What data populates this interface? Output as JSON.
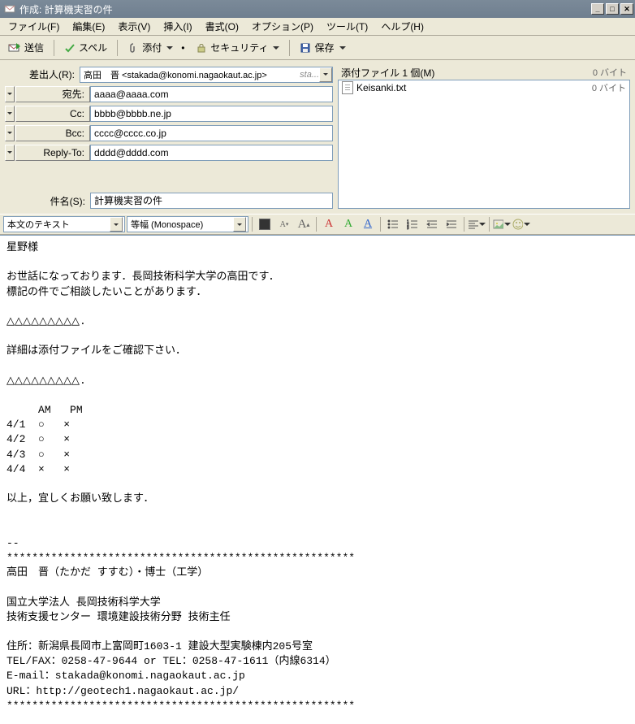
{
  "window": {
    "title": "作成: 計算機実習の件"
  },
  "menu": {
    "file": "ファイル(F)",
    "edit": "編集(E)",
    "view": "表示(V)",
    "insert": "挿入(I)",
    "format": "書式(O)",
    "options": "オプション(P)",
    "tools": "ツール(T)",
    "help": "ヘルプ(H)"
  },
  "toolbar": {
    "send": "送信",
    "spell": "スペル",
    "attach": "添付",
    "security": "セキュリティ",
    "save": "保存"
  },
  "headers": {
    "from_label": "差出人(R):",
    "from_value": "高田　晋 <stakada@konomi.nagaokaut.ac.jp>",
    "from_extra": "sta...",
    "to_label": "宛先:",
    "to_value": "aaaa@aaaa.com",
    "cc_label": "Cc:",
    "cc_value": "bbbb@bbbb.ne.jp",
    "bcc_label": "Bcc:",
    "bcc_value": "cccc@cccc.co.jp",
    "replyto_label": "Reply-To:",
    "replyto_value": "dddd@dddd.com",
    "subject_label": "件名(S):",
    "subject_value": "計算機実習の件"
  },
  "attachments": {
    "header": "添付ファイル 1 個(M)",
    "header_size": "0 バイト",
    "items": [
      {
        "name": "Keisanki.txt",
        "size": "0 バイト"
      }
    ]
  },
  "format": {
    "style": "本文のテキスト",
    "font": "等幅 (Monospace)",
    "a_small": "A",
    "a_large": "A",
    "a_color1": "A",
    "a_color2": "A",
    "a_color3": "A"
  },
  "body": "星野様\n\nお世話になっております．長岡技術科学大学の高田です．\n標記の件でご相談したいことがあります．\n\n△△△△△△△△△.\n\n詳細は添付ファイルをご確認下さい．\n\n△△△△△△△△△.\n\n     AM   PM\n4/1  ○   ×\n4/2  ○   ×\n4/3  ○   ×\n4/4  ×   ×\n\n以上，宜しくお願い致します．\n\n\n--\n*******************************************************\n高田　晋（たかだ すすむ）・博士（工学）\n\n国立大学法人 長岡技術科学大学\n技術支援センター 環境建設技術分野 技術主任\n\n住所：新潟県長岡市上富岡町1603-1 建設大型実験棟内205号室\nTEL/FAX：0258-47-9644 or TEL：0258-47-1611（内線6314）\nE-mail：stakada@konomi.nagaokaut.ac.jp\nURL：http://geotech1.nagaokaut.ac.jp/\n*******************************************************"
}
